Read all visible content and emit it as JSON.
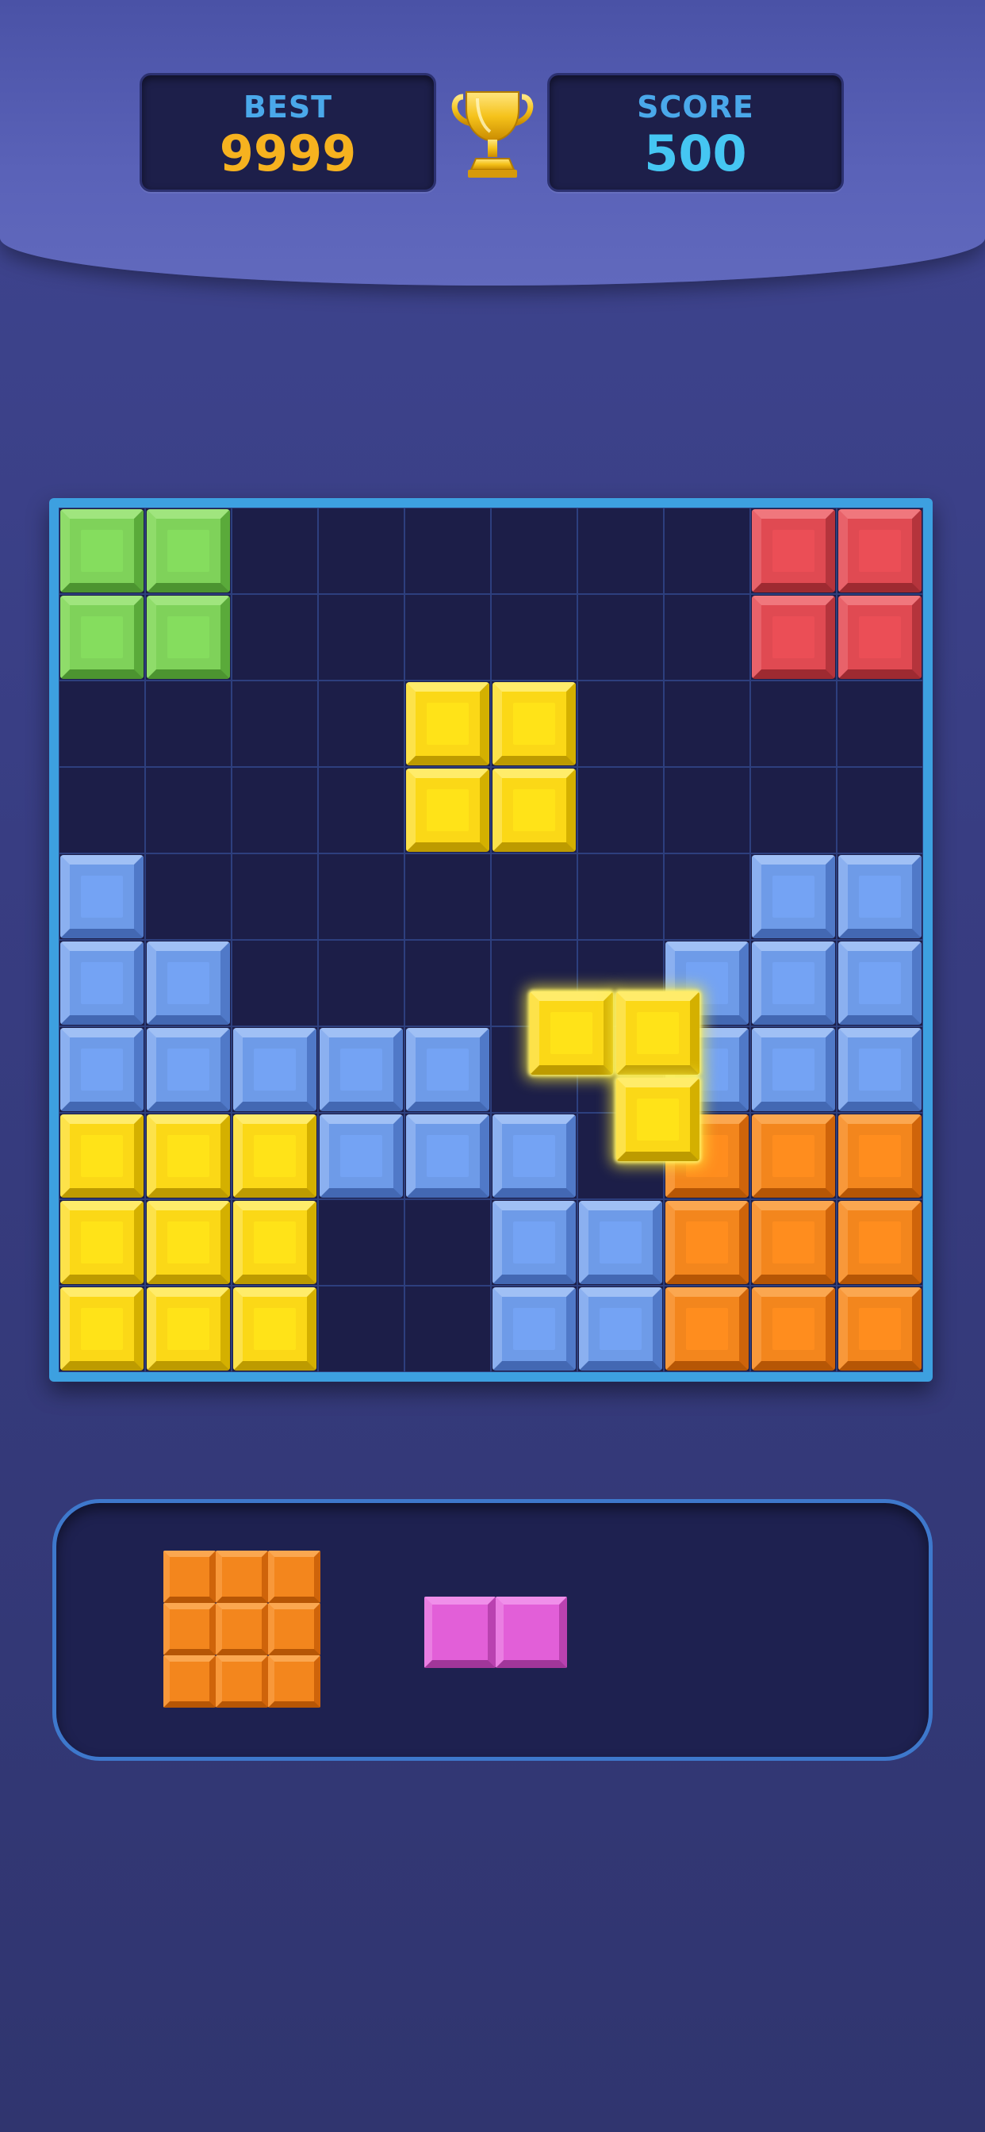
{
  "stats": {
    "best_label": "BEST",
    "best_value": "9999",
    "score_label": "SCORE",
    "score_value": "500"
  },
  "board": {
    "size": 10,
    "colors": {
      "green": "#7fd25a",
      "red": "#e04a52",
      "yellow": "#fbd817",
      "blue": "#6e9be8",
      "orange": "#f3861d",
      "pink": "#e25fd8",
      "grid_bg": "#1c1e48",
      "frame": "#3da0e0"
    },
    "rows": [
      [
        "green",
        "green",
        "",
        "",
        "",
        "",
        "",
        "",
        "red",
        "red"
      ],
      [
        "green",
        "green",
        "",
        "",
        "",
        "",
        "",
        "",
        "red",
        "red"
      ],
      [
        "",
        "",
        "",
        "",
        "yellow",
        "yellow",
        "",
        "",
        "",
        ""
      ],
      [
        "",
        "",
        "",
        "",
        "yellow",
        "yellow",
        "",
        "",
        "",
        ""
      ],
      [
        "blue",
        "",
        "",
        "",
        "",
        "",
        "",
        "",
        "blue",
        "blue"
      ],
      [
        "blue",
        "blue",
        "",
        "",
        "",
        "",
        "",
        "blue",
        "blue",
        "blue"
      ],
      [
        "blue",
        "blue",
        "blue",
        "blue",
        "blue",
        "",
        "",
        "blue",
        "blue",
        "blue"
      ],
      [
        "yellow",
        "yellow",
        "yellow",
        "blue",
        "blue",
        "blue",
        "",
        "orange",
        "orange",
        "orange"
      ],
      [
        "yellow",
        "yellow",
        "yellow",
        "",
        "",
        "blue",
        "blue",
        "orange",
        "orange",
        "orange"
      ],
      [
        "yellow",
        "yellow",
        "yellow",
        "",
        "",
        "blue",
        "blue",
        "orange",
        "orange",
        "orange"
      ]
    ],
    "dragging_piece": {
      "color": "yellow",
      "shape": "J-corner",
      "cells": [
        [
          0,
          0
        ],
        [
          0,
          1
        ],
        [
          1,
          1
        ]
      ],
      "highlight": "glow"
    }
  },
  "tray": {
    "pieces": [
      {
        "color": "orange",
        "shape": "3x3-square",
        "rows": 3,
        "cols": 3
      },
      {
        "color": "pink",
        "shape": "1x2-bar",
        "rows": 1,
        "cols": 2
      }
    ]
  },
  "icons": {
    "trophy": "trophy-icon"
  }
}
